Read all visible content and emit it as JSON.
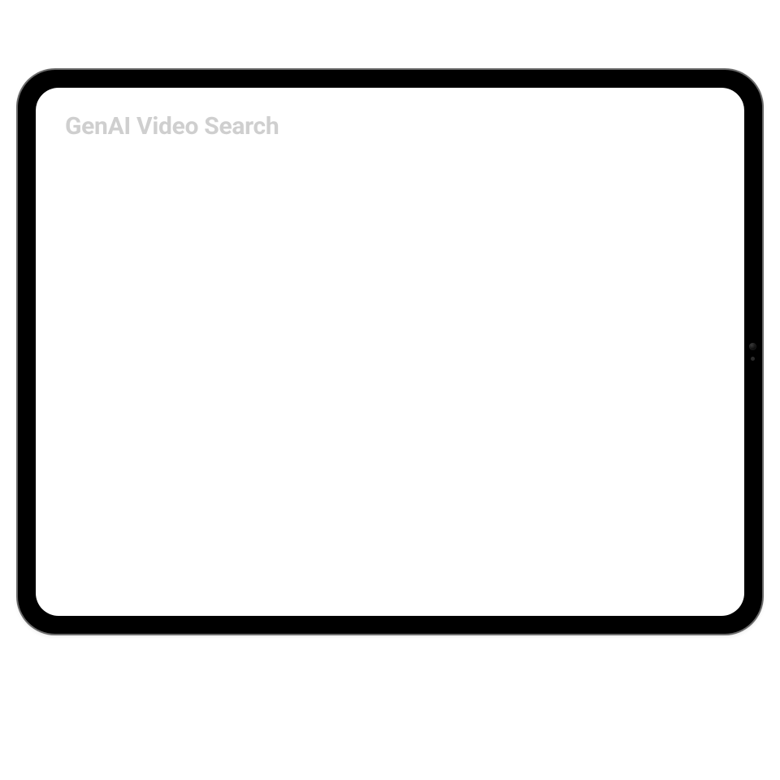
{
  "header": {
    "title": "GenAI Video Search"
  }
}
